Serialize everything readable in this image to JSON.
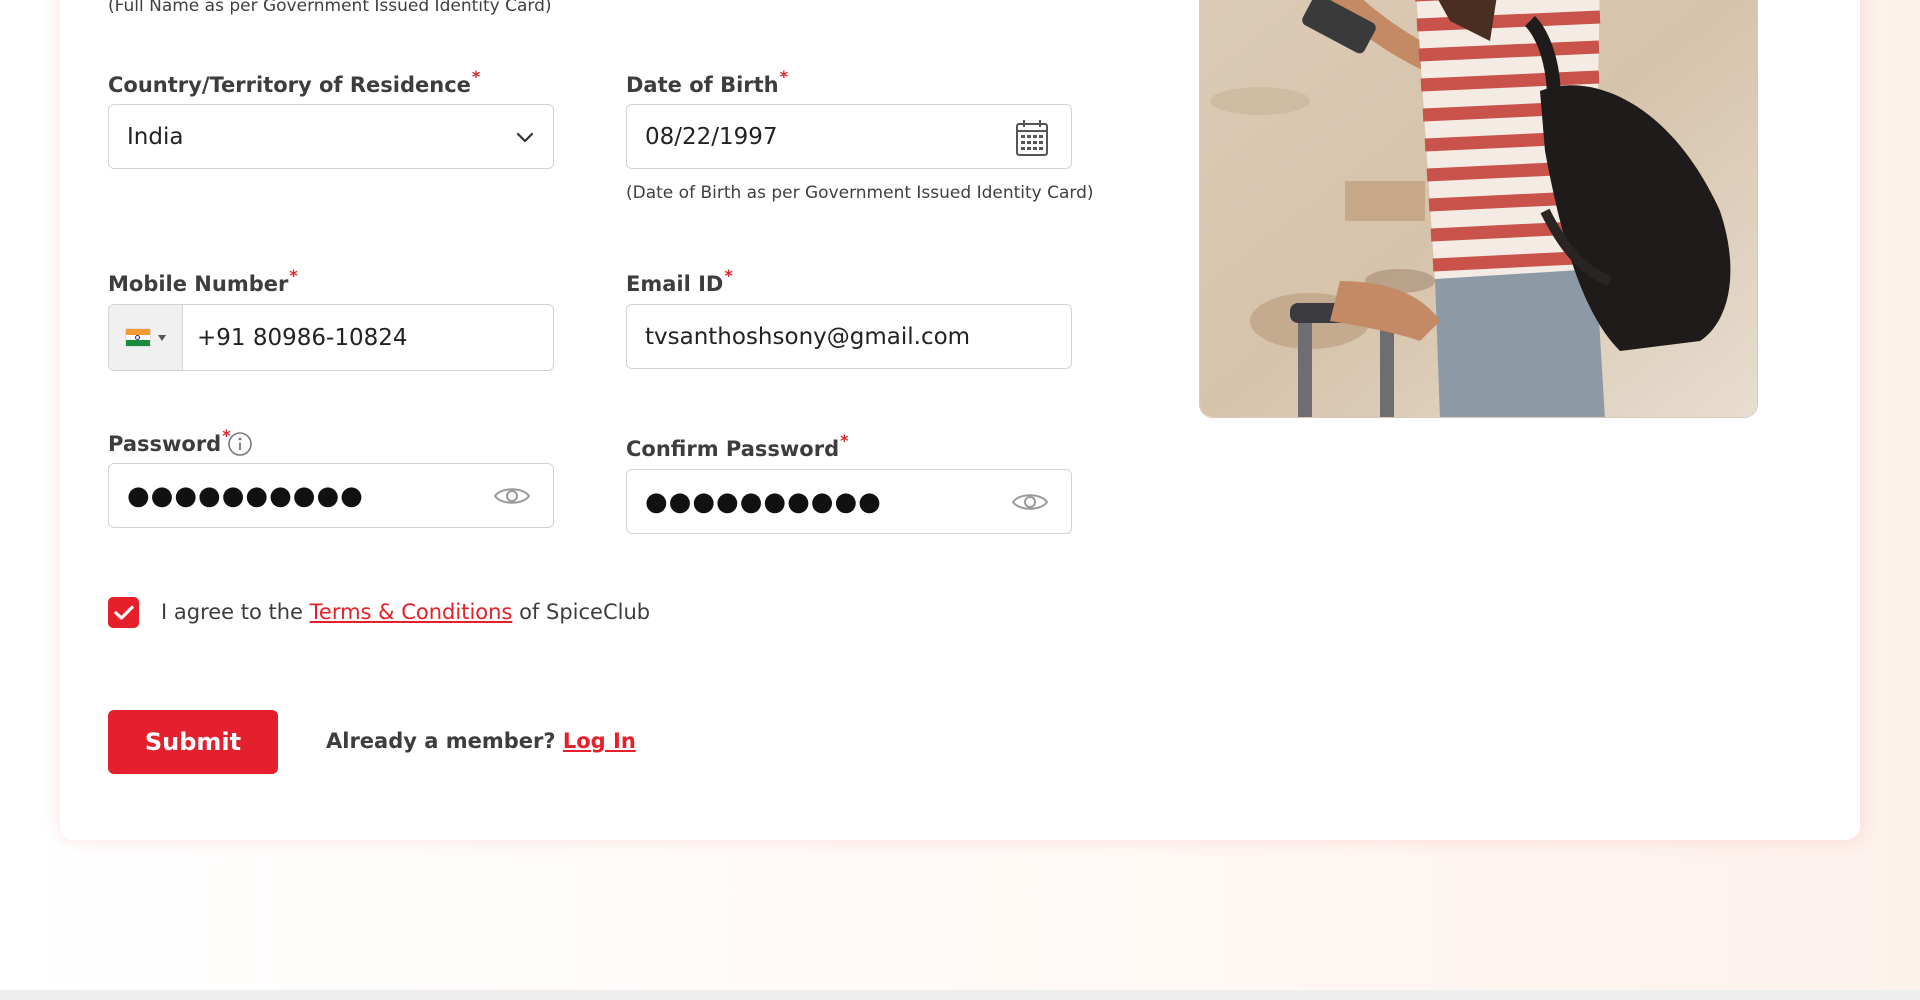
{
  "form": {
    "full_name_note": "(Full Name as per Government Issued Identity Card)",
    "country": {
      "label": "Country/Territory of Residence",
      "required_mark": "*",
      "value": "India"
    },
    "dob": {
      "label": "Date of Birth",
      "required_mark": "*",
      "value": "08/22/1997",
      "note": "(Date of Birth as per Government Issued Identity Card)"
    },
    "mobile": {
      "label": "Mobile Number",
      "required_mark": "*",
      "value": "+91 80986-10824",
      "flag_icon": "india-flag-icon"
    },
    "email": {
      "label": "Email ID",
      "required_mark": "*",
      "value": "tvsanthoshsony@gmail.com"
    },
    "password": {
      "label": "Password",
      "required_mark": "*",
      "value": "●●●●●●●●●●"
    },
    "confirm_password": {
      "label": "Confirm Password",
      "required_mark": "*",
      "value": "●●●●●●●●●●"
    },
    "terms": {
      "checked": true,
      "prefix": "I agree to the ",
      "link": "Terms & Conditions",
      "suffix": " of SpiceClub"
    },
    "submit_label": "Submit",
    "member": {
      "text": "Already a member? ",
      "link": "Log In"
    }
  },
  "colors": {
    "accent": "#e3202b",
    "border": "#d4d4d4"
  },
  "icons": [
    "chevron-down-icon",
    "calendar-icon",
    "eye-icon",
    "info-icon",
    "checkmark-icon",
    "india-flag-icon"
  ]
}
